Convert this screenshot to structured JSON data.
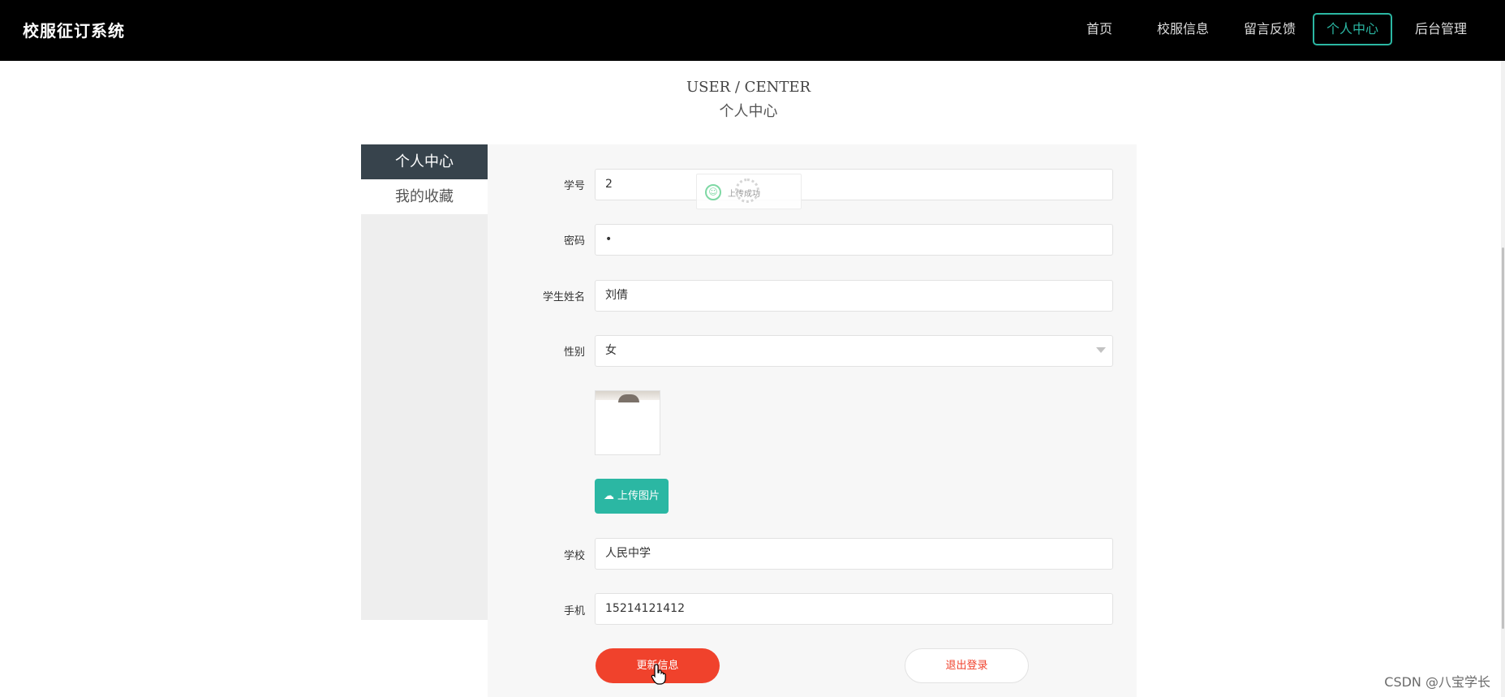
{
  "header": {
    "brand": "校服征订系统",
    "nav": [
      "首页",
      "校服信息",
      "留言反馈",
      "个人中心",
      "后台管理"
    ],
    "active_nav": "个人中心",
    "accent_color": "#2bb7a3"
  },
  "page": {
    "heading_en": "USER / CENTER",
    "heading_zh": "个人中心"
  },
  "sidebar": {
    "items": [
      "个人中心",
      "我的收藏"
    ]
  },
  "form": {
    "fields": [
      {
        "label": "学号",
        "value": "2"
      },
      {
        "label": "密码",
        "value": "•"
      },
      {
        "label": "学生姓名",
        "value": "刘倩"
      },
      {
        "label": "性别",
        "value": "女"
      },
      {
        "label": "学校",
        "value": "人民中学"
      },
      {
        "label": "手机",
        "value": "15214121412"
      }
    ],
    "upload_button": "上传图片",
    "update_button": "更新信息",
    "logout_button": "退出登录",
    "danger_color": "#f0422c"
  },
  "toast": {
    "text": "上传成功"
  },
  "watermark": "CSDN @八宝学长"
}
